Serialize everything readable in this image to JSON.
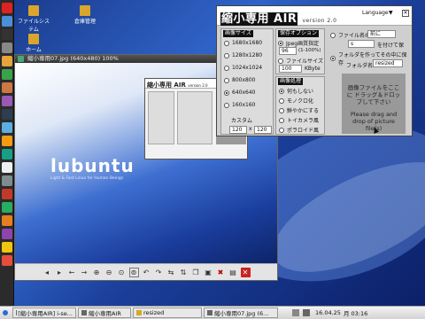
{
  "desktop": {
    "icons": [
      {
        "label": "ファイルシステム"
      },
      {
        "label": "倉庫管理"
      },
      {
        "label": "ホーム"
      }
    ]
  },
  "dock": {
    "icons": [
      "opera-icon",
      "folder-icon",
      "terminal-icon",
      "settings-icon",
      "mail-icon",
      "browser-icon",
      "music-icon",
      "image-icon",
      "video-icon",
      "chat-icon",
      "calendar-icon",
      "chart-icon",
      "notes-icon",
      "trash-icon",
      "office-icon",
      "game-icon",
      "map-icon",
      "camera-icon",
      "clock-icon",
      "power-icon"
    ]
  },
  "viewer": {
    "title": "縮小専用07.jpg (640x480) 100%",
    "logo_text": "lubuntu",
    "logo_sub": "Light & Fast Linux for Human Beings",
    "toolbar_icons": [
      "left-arrow-icon",
      "right-arrow-icon",
      "back-icon",
      "forward-icon",
      "zoom-in-icon",
      "zoom-out-icon",
      "zoom-fit-icon",
      "zoom-100-icon",
      "rotate-left-icon",
      "rotate-right-icon",
      "flip-h-icon",
      "flip-v-icon",
      "copy-icon",
      "save-icon",
      "delete-icon",
      "preferences-icon",
      "close-icon"
    ],
    "mini_title": "縮小専用 AIR",
    "mini_version": "version 2.0"
  },
  "app": {
    "title": "縮小専用 AIR",
    "version": "version 2.0",
    "language_label": "Language",
    "language_arrow": "▼",
    "size_header": "画像サイズ",
    "sizes": [
      {
        "label": "1680x1680",
        "selected": false
      },
      {
        "label": "1280x1280",
        "selected": false
      },
      {
        "label": "1024x1024",
        "selected": false
      },
      {
        "label": "800x800",
        "selected": false
      },
      {
        "label": "640x640",
        "selected": true
      },
      {
        "label": "160x160",
        "selected": false
      }
    ],
    "custom_label": "カスタム",
    "custom_w": "120",
    "custom_x": "x",
    "custom_h": "120",
    "save_header": "保存オプション",
    "jpeg_label": "Jpeg画質指定",
    "jpeg_value": "96",
    "jpeg_range": "(1-100%)",
    "filesize_label": "ファイルサイズ",
    "filesize_value": "100",
    "filesize_unit": "KByte",
    "effect_header": "画像処理",
    "effects": [
      {
        "label": "何もしない",
        "selected": true
      },
      {
        "label": "モノクロ化",
        "selected": false
      },
      {
        "label": "鮮やかにする",
        "selected": false
      },
      {
        "label": "トイカメラ風",
        "selected": false
      },
      {
        "label": "ポラロイド風",
        "selected": false
      }
    ],
    "filename_label": "ファイル名の",
    "filename_select": "前に",
    "filename_value": "s",
    "filename_suffix": "を付けて保",
    "folder_option_label": "フォルダを作ってその中に保存",
    "folder_name_label": "フォルダ名",
    "folder_name_value": "resized",
    "drop_jp": "画像ファイルをここに ドラッグ＆ドロップして下さい",
    "drop_en": "Please drag and drop of picture file(s)"
  },
  "taskbar": {
    "items": [
      {
        "label": "[縮小専用AIR] i-se..."
      },
      {
        "label": "縮小専用AIR"
      },
      {
        "label": "resized"
      },
      {
        "label": "縮小専用07.jpg (6..."
      }
    ],
    "date": "16.04.25",
    "time": "月 03:16"
  },
  "colors": {
    "desktop_blue": "#2f63c8",
    "taskbar": "#e4e4e4",
    "app_header_black": "#111111"
  }
}
